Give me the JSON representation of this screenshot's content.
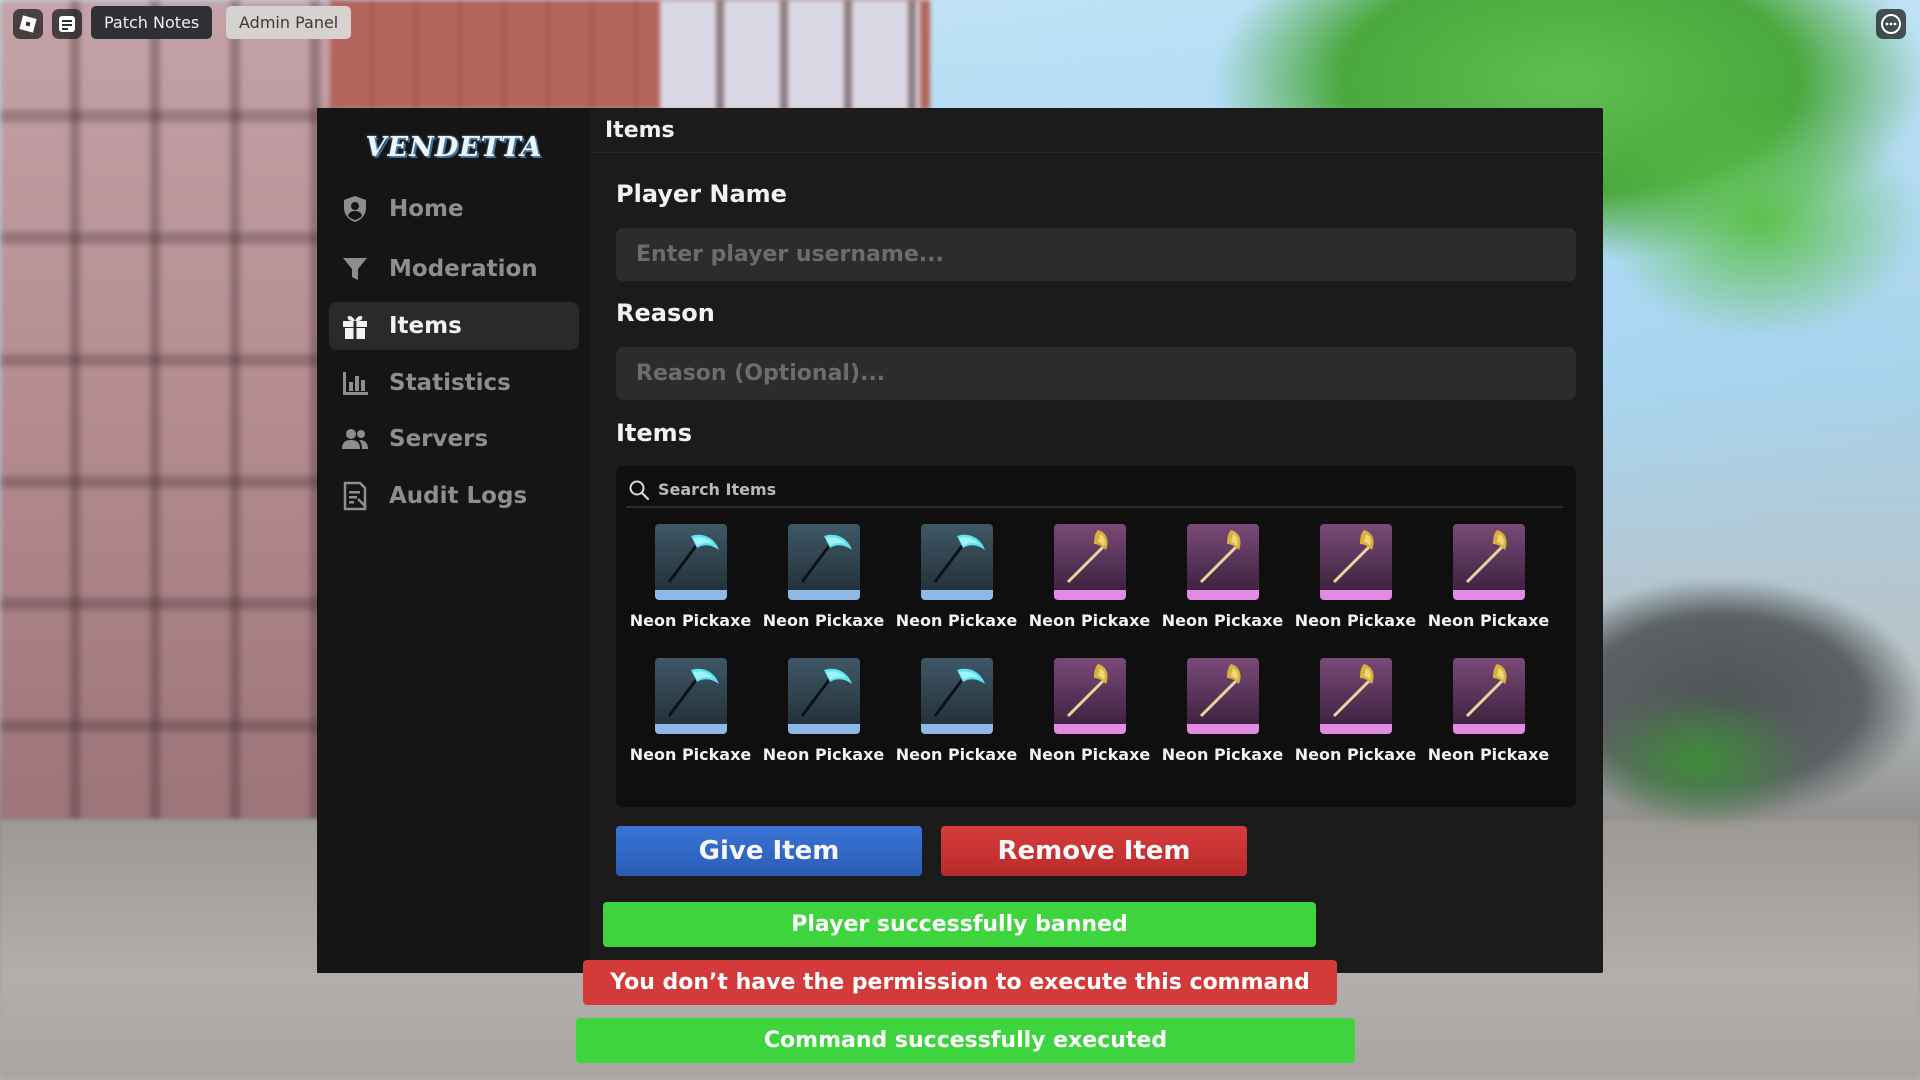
{
  "topbar": {
    "tabs": [
      {
        "label": "Patch Notes"
      },
      {
        "label": "Admin Panel"
      }
    ]
  },
  "panel": {
    "logo_text": "VENDETTA",
    "header_title": "Items",
    "nav": [
      {
        "label": "Home",
        "icon": "shield-user-icon",
        "active": false
      },
      {
        "label": "Moderation",
        "icon": "funnel-icon",
        "active": false
      },
      {
        "label": "Items",
        "icon": "gift-icon",
        "active": true
      },
      {
        "label": "Statistics",
        "icon": "bar-chart-icon",
        "active": false
      },
      {
        "label": "Servers",
        "icon": "users-icon",
        "active": false
      },
      {
        "label": "Audit Logs",
        "icon": "document-icon",
        "active": false
      }
    ],
    "player_name": {
      "label": "Player Name",
      "value": "",
      "placeholder": "Enter player username..."
    },
    "reason": {
      "label": "Reason",
      "value": "",
      "placeholder": "Reason (Optional)..."
    },
    "items": {
      "label": "Items",
      "search_placeholder": "Search Items",
      "list": [
        {
          "name": "Neon Pickaxe",
          "variant": "cyan-scythe"
        },
        {
          "name": "Neon Pickaxe",
          "variant": "cyan-scythe"
        },
        {
          "name": "Neon Pickaxe",
          "variant": "cyan-scythe"
        },
        {
          "name": "Neon Pickaxe",
          "variant": "gold-axe"
        },
        {
          "name": "Neon Pickaxe",
          "variant": "gold-axe"
        },
        {
          "name": "Neon Pickaxe",
          "variant": "gold-axe"
        },
        {
          "name": "Neon Pickaxe",
          "variant": "gold-axe"
        },
        {
          "name": "Neon Pickaxe",
          "variant": "cyan-scythe"
        },
        {
          "name": "Neon Pickaxe",
          "variant": "cyan-scythe"
        },
        {
          "name": "Neon Pickaxe",
          "variant": "cyan-scythe"
        },
        {
          "name": "Neon Pickaxe",
          "variant": "gold-axe"
        },
        {
          "name": "Neon Pickaxe",
          "variant": "gold-axe"
        },
        {
          "name": "Neon Pickaxe",
          "variant": "gold-axe"
        },
        {
          "name": "Neon Pickaxe",
          "variant": "gold-axe"
        }
      ]
    },
    "buttons": {
      "give": "Give Item",
      "remove": "Remove Item"
    }
  },
  "notifications": [
    {
      "text": "Player successfully banned",
      "status": "success"
    },
    {
      "text": "You don’t have the permission to execute this command",
      "status": "error"
    },
    {
      "text": "Command successfully executed",
      "status": "success"
    }
  ],
  "colors": {
    "success": "#3ed43e",
    "error": "#d53a3a",
    "give_button": "#3a74d6",
    "remove_button": "#d63c3c",
    "cyan_item_bar": "#8fb8e6",
    "pink_item_bar": "#e18be2"
  }
}
